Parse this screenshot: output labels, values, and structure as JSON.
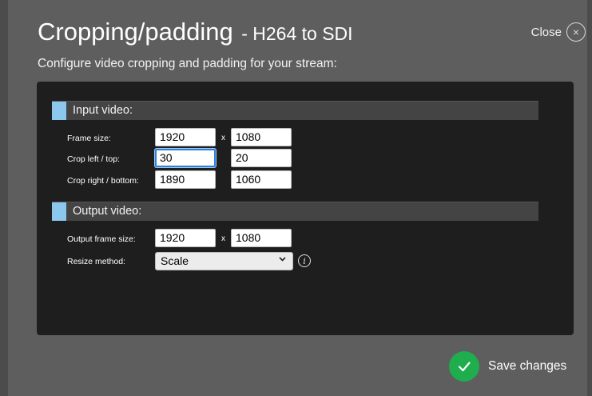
{
  "dialog": {
    "title": "Cropping/padding",
    "subtitle_suffix": "- H264 to SDI",
    "close_label": "Close",
    "close_glyph": "×",
    "description": "Configure video cropping and padding for your stream:"
  },
  "input_section": {
    "heading": "Input video:",
    "frame_size": {
      "label": "Frame size:",
      "width": "1920",
      "height": "1080"
    },
    "crop_left_top": {
      "label": "Crop left / top:",
      "left": "30",
      "top": "20"
    },
    "crop_right_bottom": {
      "label": "Crop right / bottom:",
      "right": "1890",
      "bottom": "1060"
    }
  },
  "output_section": {
    "heading": "Output video:",
    "output_frame_size": {
      "label": "Output frame size:",
      "width": "1920",
      "height": "1080"
    },
    "resize_method": {
      "label": "Resize method:",
      "selected": "Scale"
    }
  },
  "separator": "x",
  "info_glyph": "i",
  "chevron_glyph": "⌄",
  "footer": {
    "save_label": "Save changes"
  },
  "colors": {
    "overlay": "#5e5e5e",
    "panel": "#1e1e1e",
    "section_bar": "#444444",
    "accent_swatch": "#8cc8ee",
    "focus_ring": "#2f7fd8",
    "save_green": "#1fad4d"
  },
  "icons": {
    "close": "close-circle-icon",
    "info": "info-icon",
    "save": "checkmark-icon",
    "dropdown": "chevron-down-icon"
  }
}
